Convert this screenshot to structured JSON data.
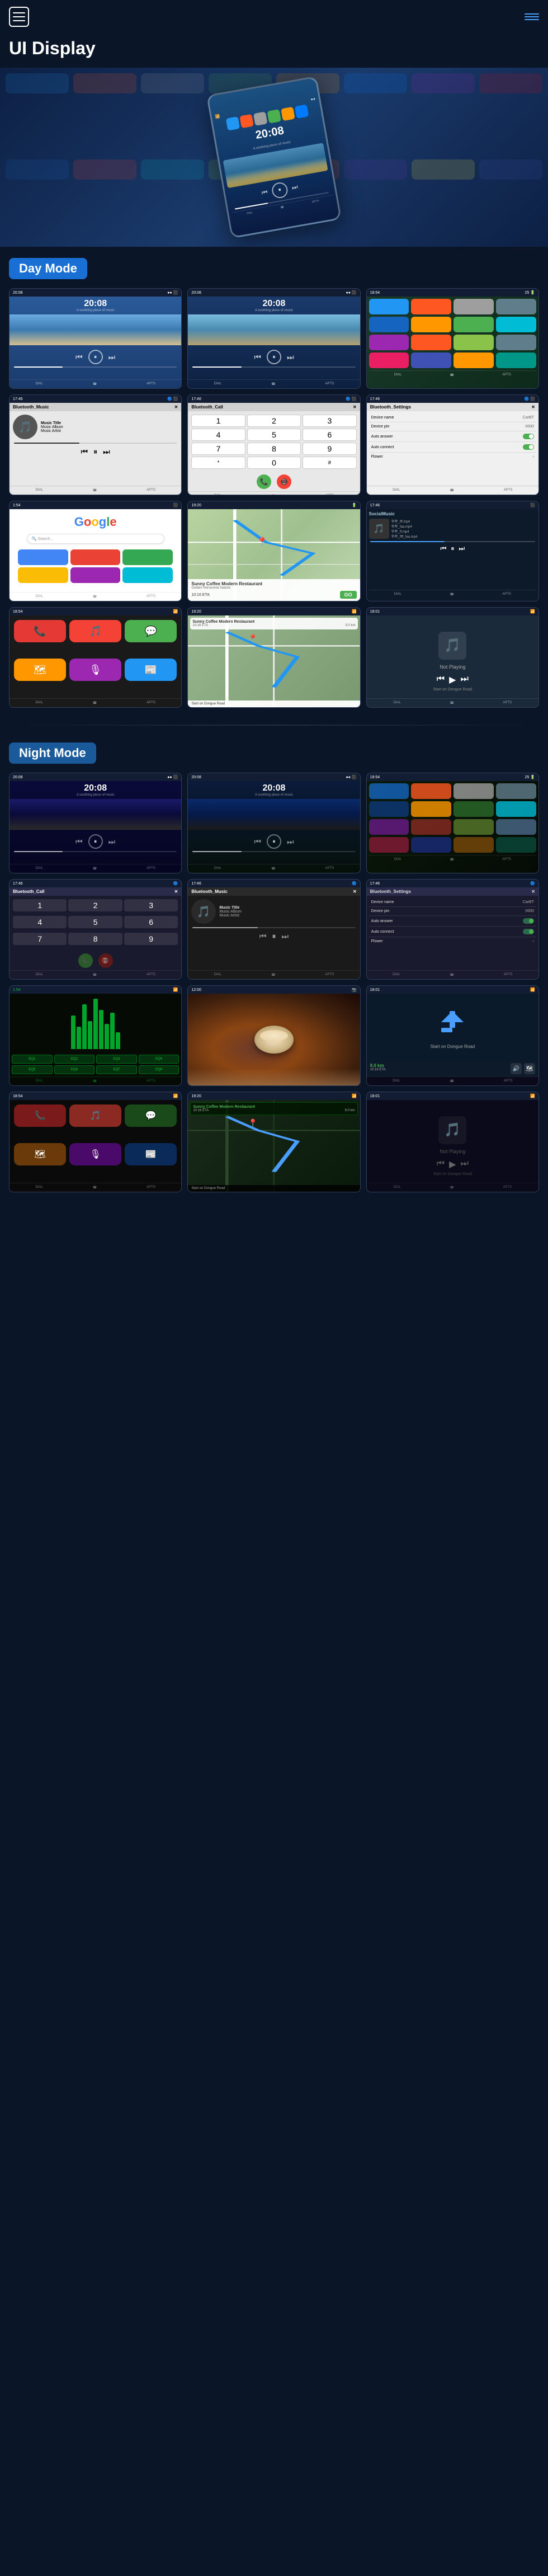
{
  "header": {
    "title": "UI Display",
    "hamburger_label": "Menu",
    "nav_label": "Navigation"
  },
  "day_mode": {
    "label": "Day Mode"
  },
  "night_mode": {
    "label": "Night Mode"
  },
  "screens": {
    "music_time": "20:08",
    "music_subtitle": "A soothing piece of music",
    "bluetooth_music": "Bluetooth_Music",
    "bluetooth_call": "Bluetooth_Call",
    "bluetooth_settings": "Bluetooth_Settings",
    "device_name_label": "Device name",
    "device_name_value": "CarBT",
    "device_pin_label": "Device pin",
    "device_pin_value": "0000",
    "auto_answer_label": "Auto answer",
    "auto_connect_label": "Auto connect",
    "flower_label": "Flower",
    "music_title": "Music Title",
    "music_album": "Music Album",
    "music_artist": "Music Artist",
    "google_text": "Google",
    "sunny_coffee": "Sunny Coffee Modern Restaurant",
    "sunny_address": "Golden Horseshoe Nature",
    "eta_label": "10:16 ETA",
    "distance_label": "9.0 km",
    "time_display": "10:16 ETA",
    "go_label": "GO",
    "not_playing": "Not Playing",
    "dongue_road": "Start on Dongue Road",
    "social_music": "SocialMusic",
    "song1": "华年_fff.mp4",
    "song2": "华年_faa.mp4",
    "song3": "华年_ff.mp4",
    "song4": "华年_ffff_faa.mp4",
    "nav_info": "19:16 ETA  9.0 km",
    "nav_direction": "Start on Dongue Road"
  },
  "app_colors": {
    "telegram": "#2196F3",
    "music": "#FF5722",
    "settings": "#9E9E9E",
    "phone": "#4CAF50",
    "messages": "#4CAF50",
    "maps": "#FF9800",
    "safari": "#2196F3",
    "appstore": "#007AFF",
    "podcasts": "#9C27B0",
    "news": "#F44336",
    "bt": "#1565C0",
    "waze": "#1a8cff",
    "netflix": "#E50914"
  }
}
